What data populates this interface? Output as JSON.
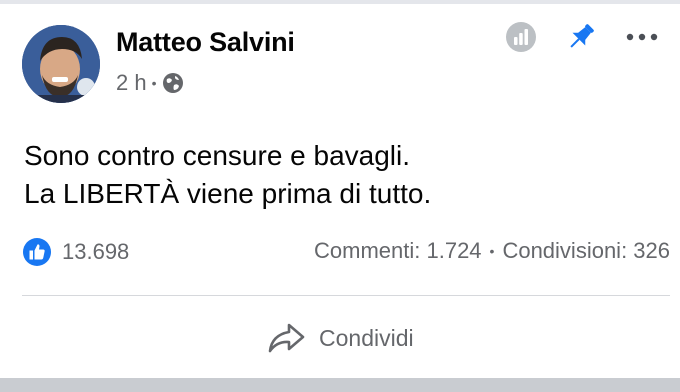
{
  "post": {
    "author": "Matteo Salvini",
    "time": "2 h",
    "separator": "•",
    "text_lines": [
      "Sono contro censure e bavagli.",
      "La LIBERTÀ viene prima di tutto."
    ],
    "reactions_count": "13.698",
    "comments_label": "Commenti: 1.724",
    "stats_separator": "•",
    "shares_label": "Condivisioni: 326",
    "share_button_label": "Condividi"
  },
  "icons": {
    "insights": "insights-icon",
    "pin": "pin-icon",
    "more": "more-options-icon",
    "globe": "globe-icon",
    "like": "like-icon",
    "share": "share-icon"
  },
  "colors": {
    "accent": "#1877f2",
    "secondary_text": "#65676b",
    "primary_text": "#050505",
    "icon_gray": "#bcc0c4"
  }
}
